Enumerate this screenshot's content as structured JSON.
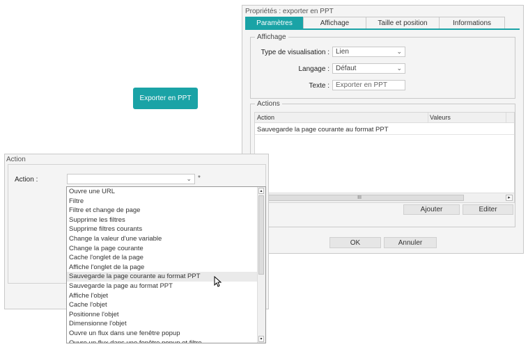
{
  "export_button": {
    "label": "Exporter en PPT"
  },
  "props_dialog": {
    "title": "Propriétés : exporter en PPT",
    "tabs": [
      "Paramètres",
      "Affichage",
      "Taille et position",
      "Informations"
    ],
    "affichage": {
      "legend": "Affichage",
      "type_label": "Type de visualisation :",
      "type_value": "Lien",
      "langage_label": "Langage :",
      "langage_value": "Défaut",
      "texte_label": "Texte :",
      "texte_value": "Exporter en PPT"
    },
    "actions": {
      "legend": "Actions",
      "col_action": "Action",
      "col_valeurs": "Valeurs",
      "rows": [
        "Sauvegarde la page courante au format PPT"
      ],
      "scroll_grip": "III"
    },
    "ajouter": "Ajouter",
    "editer": "Editer",
    "ok": "OK",
    "annuler": "Annuler"
  },
  "action_dialog": {
    "title": "Action",
    "action_label": "Action :",
    "required_mark": "*",
    "options": [
      "Ouvre une URL",
      "Filtre",
      "Filtre et change de page",
      "Supprime les filtres",
      "Supprime filtres courants",
      "Change la valeur d'une variable",
      "Change la page courante",
      "Cache l'onglet de la page",
      "Affiche l'onglet de la page",
      "Sauvegarde la page courante au format PPT",
      "Sauvegarde la page au format PPT",
      "Affiche l'objet",
      "Cache l'objet",
      "Positionne l'objet",
      "Dimensionne l'objet",
      "Ouvre un flux dans une fenêtre popup",
      "Ouvre un flux dans une fenêtre popup et filtre"
    ],
    "hovered_index": 9
  },
  "colors": {
    "accent": "#1aa3a6"
  }
}
